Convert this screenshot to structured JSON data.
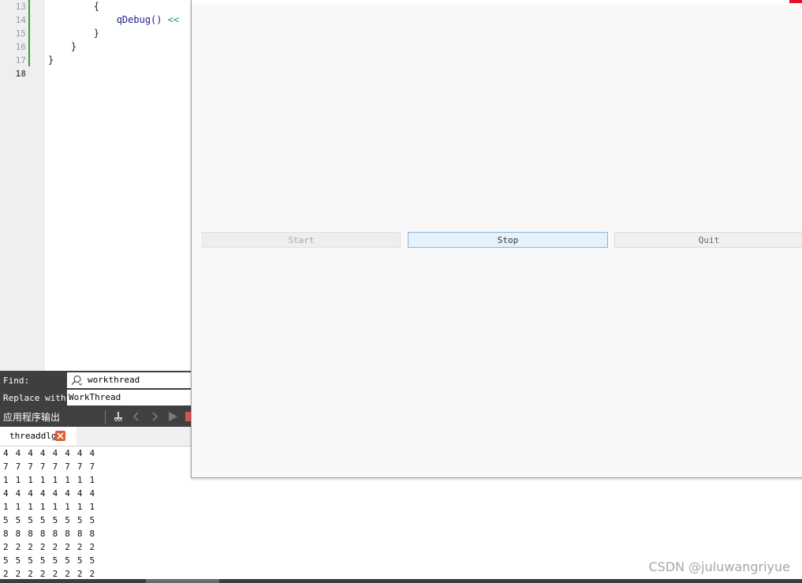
{
  "editor": {
    "lines": [
      {
        "num": "13",
        "code": "        {"
      },
      {
        "num": "14",
        "code": "            qDebug() <<"
      },
      {
        "num": "15",
        "code": "        }"
      },
      {
        "num": "16",
        "code": "    }"
      },
      {
        "num": "17",
        "code": "}"
      },
      {
        "num": "18",
        "code": ""
      }
    ],
    "line14_indent": "            ",
    "line14_func": "qDebug()",
    "line14_op": " <<"
  },
  "find_bar": {
    "find_label": "Find:",
    "find_value": "workthread",
    "replace_label": "Replace with:",
    "replace_value": "WorkThread"
  },
  "output_pane": {
    "title": "应用程序输出",
    "tab_label": "threaddlg",
    "rows": [
      "4 4 4 4 4 4 4 4",
      "7 7 7 7 7 7 7 7",
      "1 1 1 1 1 1 1 1",
      "4 4 4 4 4 4 4 4",
      "1 1 1 1 1 1 1 1",
      "5 5 5 5 5 5 5 5",
      "8 8 8 8 8 8 8 8",
      "2 2 2 2 2 2 2 2",
      "5 5 5 5 5 5 5 5",
      "2 2 2 2 2 2 2 2"
    ]
  },
  "dialog": {
    "start_label": "Start",
    "stop_label": "Stop",
    "quit_label": "Quit"
  },
  "watermark": "CSDN @juluwangriyue",
  "colors": {
    "change_marker": "#33a133",
    "close_red": "#e81123",
    "stop_button_focus": "#87b7e0"
  }
}
